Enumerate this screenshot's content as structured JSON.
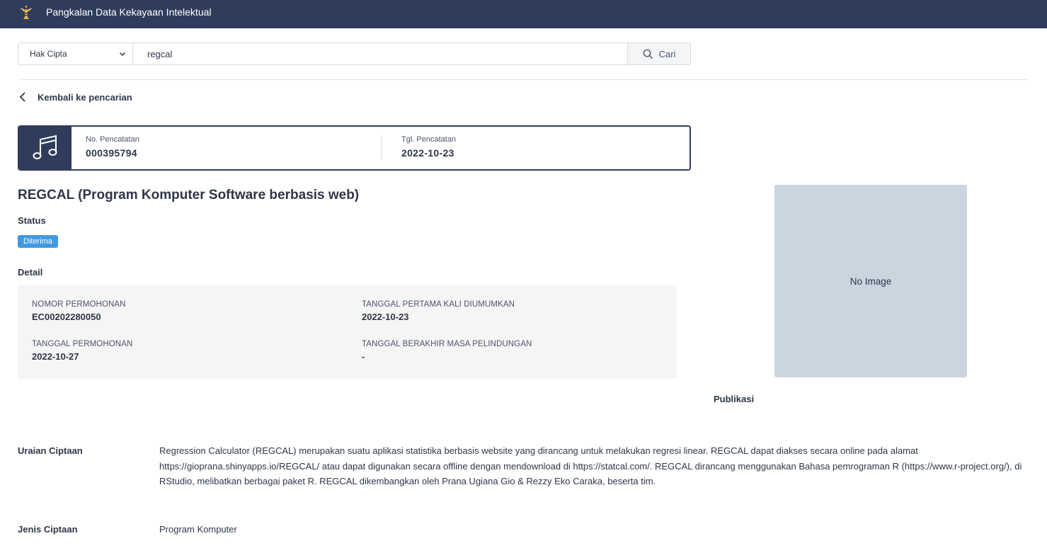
{
  "header": {
    "app_title": "Pangkalan Data Kekayaan Intelektual",
    "brand_color": "#2f3c5c"
  },
  "search": {
    "category_selected": "Hak Cipta",
    "query_value": "regcal",
    "button_label": "Cari"
  },
  "navigation": {
    "back_label": "Kembali ke pencarian"
  },
  "record": {
    "icon": "music-note-icon",
    "no_label": "No. Pencatatan",
    "no_value": "000395794",
    "date_label": "Tgl. Pencatatan",
    "date_value": "2022-10-23"
  },
  "work": {
    "title": "REGCAL (Program Komputer Software berbasis web)",
    "status_label": "Status",
    "status_value": "Diterima",
    "status_color": "#4299e1",
    "detail_label": "Detail"
  },
  "details": {
    "nomor_permohonan_label": "NOMOR PERMOHONAN",
    "nomor_permohonan_value": "EC00202280050",
    "tanggal_pertama_label": "TANGGAL PERTAMA KALI DIUMUMKAN",
    "tanggal_pertama_value": "2022-10-23",
    "tanggal_permohonan_label": "TANGGAL PERMOHONAN",
    "tanggal_permohonan_value": "2022-10-27",
    "tanggal_berakhir_label": "TANGGAL BERAKHIR MASA PELINDUNGAN",
    "tanggal_berakhir_value": "-"
  },
  "image": {
    "placeholder_text": "No Image"
  },
  "publikasi_label": "Publikasi",
  "uraian": {
    "label": "Uraian Ciptaan",
    "value": "Regression Calculator (REGCAL) merupakan suatu aplikasi statistika berbasis website yang dirancang untuk melakukan regresi linear. REGCAL dapat diakses secara online pada alamat https://gioprana.shinyapps.io/REGCAL/ atau dapat digunakan secara offline dengan mendownload di https://statcal.com/. REGCAL dirancang menggunakan Bahasa pemrograman R (https://www.r-project.org/), di RStudio, melibatkan berbagai paket R. REGCAL dikembangkan oleh Prana Ugiana Gio & Rezzy Eko Caraka, beserta tim."
  },
  "jenis": {
    "label": "Jenis Ciptaan",
    "value": "Program Komputer"
  }
}
